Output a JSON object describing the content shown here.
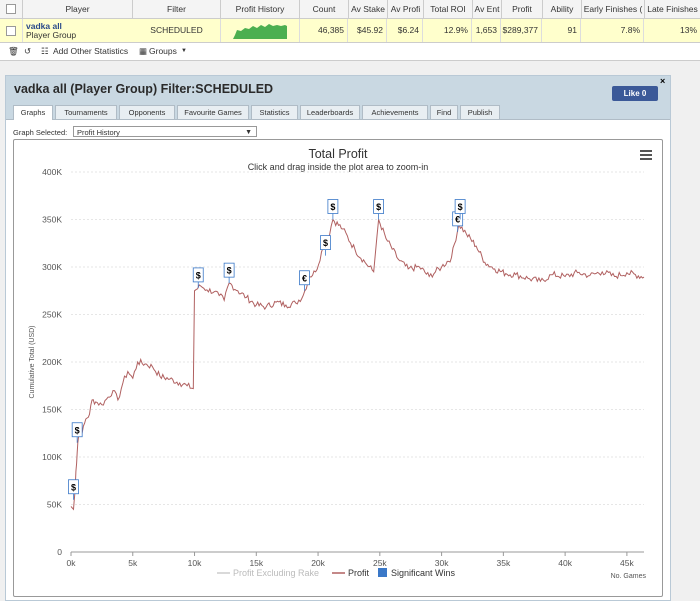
{
  "table": {
    "headers": [
      "Player",
      "Filter",
      "Profit History",
      "Count",
      "Av Stake",
      "Av Profi",
      "Total ROI",
      "Av Ent",
      "Profit",
      "Ability",
      "Early Finishes (",
      "Late Finishes"
    ],
    "row": {
      "player_name": "vadka all",
      "player_type": "Player Group",
      "filter": "SCHEDULED",
      "count": "46,385",
      "av_stake": "$45.92",
      "av_profit": "$6.24",
      "total_roi": "12.9%",
      "av_ent": "1,653",
      "profit": "$289,377",
      "ability": "91",
      "early_finishes": "7.8%",
      "late_finishes": "13%"
    }
  },
  "toolbar": {
    "add_stats": "Add Other Statistics",
    "groups": "Groups"
  },
  "panel": {
    "title": "vadka all (Player Group) Filter:SCHEDULED",
    "like_label": "Like 0",
    "close": "×",
    "tabs": [
      "Graphs",
      "Tournaments",
      "Opponents",
      "Favourite Games",
      "Statistics",
      "Leaderboards",
      "Achievements",
      "Find",
      "Publish"
    ],
    "graph_selected_label": "Graph Selected:",
    "graph_selected_value": "Profit History"
  },
  "chart_data": {
    "type": "line",
    "title": "Total Profit",
    "subtitle": "Click and drag inside the plot area to zoom-in",
    "ylabel": "Cumulative Total (USD)",
    "xlabel": "No. Games",
    "xlim": [
      0,
      46385
    ],
    "ylim": [
      0,
      400000
    ],
    "x_ticks": [
      "0k",
      "5k",
      "10k",
      "15k",
      "20k",
      "25k",
      "30k",
      "35k",
      "40k",
      "45k"
    ],
    "y_ticks": [
      "0",
      "50K",
      "100K",
      "150K",
      "200K",
      "250K",
      "300K",
      "350K",
      "400K"
    ],
    "legend": [
      {
        "name": "Profit Excluding Rake",
        "color": "#cccccc"
      },
      {
        "name": "Profit",
        "color": "#b06060"
      },
      {
        "name": "Significant Wins",
        "color": "#3a78c8"
      }
    ],
    "series": [
      {
        "name": "Profit",
        "color": "#b06060",
        "points": [
          [
            0,
            48000
          ],
          [
            200,
            45000
          ],
          [
            300,
            60000
          ],
          [
            400,
            85000
          ],
          [
            500,
            105000
          ],
          [
            550,
            115000
          ],
          [
            700,
            130000
          ],
          [
            900,
            125000
          ],
          [
            1200,
            140000
          ],
          [
            1500,
            145000
          ],
          [
            1700,
            160000
          ],
          [
            2000,
            158000
          ],
          [
            2500,
            155000
          ],
          [
            3000,
            163000
          ],
          [
            3400,
            170000
          ],
          [
            3800,
            160000
          ],
          [
            4200,
            178000
          ],
          [
            4600,
            190000
          ],
          [
            5000,
            183000
          ],
          [
            5400,
            200000
          ],
          [
            6000,
            198000
          ],
          [
            6600,
            195000
          ],
          [
            7200,
            185000
          ],
          [
            8000,
            182000
          ],
          [
            8800,
            178000
          ],
          [
            9400,
            175000
          ],
          [
            9900,
            172000
          ],
          [
            10000,
            275000
          ],
          [
            10500,
            280000
          ],
          [
            11000,
            276000
          ],
          [
            11600,
            274000
          ],
          [
            12000,
            270000
          ],
          [
            12400,
            265000
          ],
          [
            12800,
            283000
          ],
          [
            13500,
            275000
          ],
          [
            14200,
            268000
          ],
          [
            15000,
            260000
          ],
          [
            15800,
            258000
          ],
          [
            16600,
            263000
          ],
          [
            17400,
            260000
          ],
          [
            18200,
            262000
          ],
          [
            18800,
            270000
          ],
          [
            19300,
            290000
          ],
          [
            19800,
            295000
          ],
          [
            20400,
            320000
          ],
          [
            20800,
            330000
          ],
          [
            21200,
            350000
          ],
          [
            22000,
            340000
          ],
          [
            23000,
            318000
          ],
          [
            23800,
            305000
          ],
          [
            24500,
            295000
          ],
          [
            24900,
            350000
          ],
          [
            25500,
            330000
          ],
          [
            26500,
            308000
          ],
          [
            27300,
            298000
          ],
          [
            28200,
            300000
          ],
          [
            29000,
            290000
          ],
          [
            30000,
            300000
          ],
          [
            30800,
            310000
          ],
          [
            31400,
            345000
          ],
          [
            32000,
            335000
          ],
          [
            32800,
            322000
          ],
          [
            33500,
            305000
          ],
          [
            34300,
            298000
          ],
          [
            35200,
            293000
          ],
          [
            36000,
            292000
          ],
          [
            37000,
            288000
          ],
          [
            38000,
            285000
          ],
          [
            39000,
            292000
          ],
          [
            40000,
            290000
          ],
          [
            41000,
            294000
          ],
          [
            42000,
            291000
          ],
          [
            43000,
            295000
          ],
          [
            44000,
            290000
          ],
          [
            45000,
            294000
          ],
          [
            46385,
            289377
          ]
        ]
      }
    ],
    "significant_wins": [
      {
        "x": 200,
        "y": 55000,
        "symbol": "$"
      },
      {
        "x": 500,
        "y": 115000,
        "symbol": "$"
      },
      {
        "x": 10300,
        "y": 278000,
        "symbol": "$"
      },
      {
        "x": 12800,
        "y": 283000,
        "symbol": "$"
      },
      {
        "x": 18900,
        "y": 275000,
        "symbol": "€"
      },
      {
        "x": 20600,
        "y": 312000,
        "symbol": "$"
      },
      {
        "x": 21200,
        "y": 350000,
        "symbol": "$"
      },
      {
        "x": 24900,
        "y": 350000,
        "symbol": "$"
      },
      {
        "x": 31300,
        "y": 337000,
        "symbol": "€"
      },
      {
        "x": 31500,
        "y": 350000,
        "symbol": "$"
      }
    ]
  }
}
